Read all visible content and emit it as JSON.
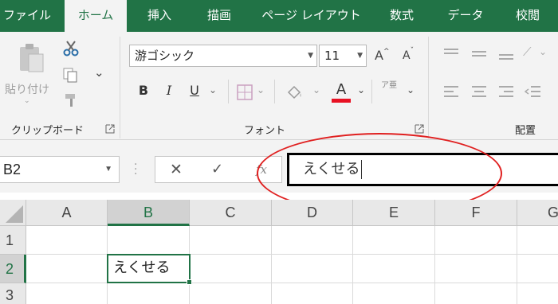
{
  "ribbon_tabs": [
    {
      "label": "ファイル",
      "active": false
    },
    {
      "label": "ホーム",
      "active": true
    },
    {
      "label": "挿入",
      "active": false
    },
    {
      "label": "描画",
      "active": false
    },
    {
      "label": "ページ レイアウト",
      "active": false
    },
    {
      "label": "数式",
      "active": false
    },
    {
      "label": "データ",
      "active": false
    },
    {
      "label": "校閲",
      "active": false
    }
  ],
  "clipboard": {
    "paste_label": "貼り付け",
    "group_label": "クリップボード",
    "icons": [
      "paste-icon",
      "cut-icon",
      "copy-icon",
      "format-painter-icon"
    ]
  },
  "font": {
    "group_label": "フォント",
    "font_name": "游ゴシック",
    "font_size": "11",
    "grow_label": "A",
    "shrink_label": "A",
    "bold_label": "B",
    "italic_label": "I",
    "underline_label": "U",
    "font_color_label": "A",
    "font_color": "#e81123",
    "phonetic_label": "ア亜",
    "icons": [
      "borders-icon",
      "fill-color-icon",
      "font-color-icon",
      "phonetic-guide-icon"
    ]
  },
  "alignment": {
    "group_label": "配置",
    "icons": [
      "align-top-icon",
      "align-middle-icon",
      "orientation-icon",
      "align-left-icon",
      "align-center-icon",
      "align-right-icon"
    ]
  },
  "formula_bar": {
    "name_box": "B2",
    "cancel_icon": "✕",
    "enter_icon": "✓",
    "function_icon": "fx",
    "value": "えくせる"
  },
  "grid": {
    "columns": [
      "A",
      "B",
      "C",
      "D",
      "E",
      "F",
      "G"
    ],
    "rows": [
      "1",
      "2",
      "3"
    ],
    "selected_column": "B",
    "selected_row": "2",
    "active_cell_value": "えくせる"
  },
  "colors": {
    "accent": "#217346",
    "annotation": "#e02020"
  }
}
